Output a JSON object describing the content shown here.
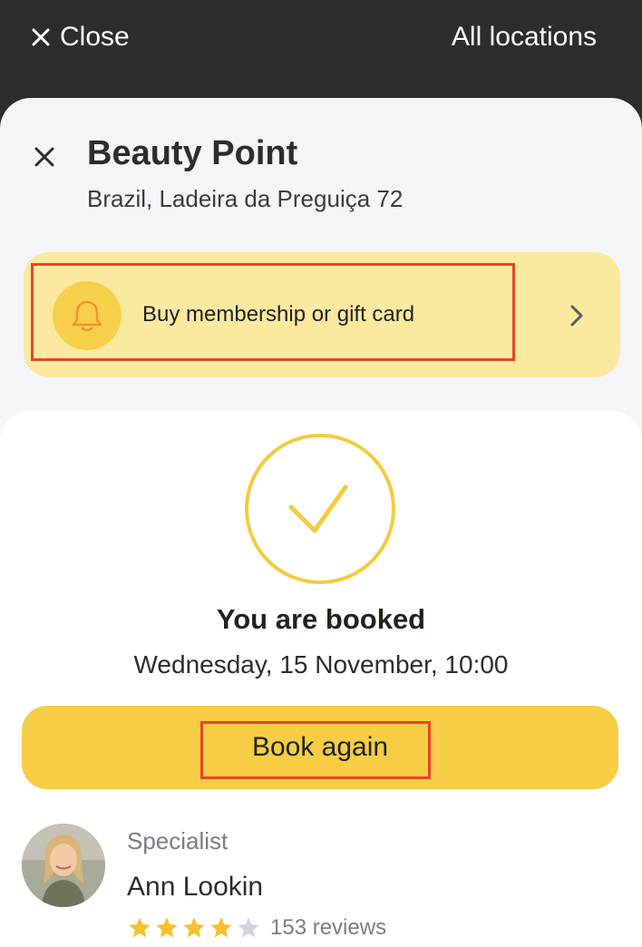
{
  "topbar": {
    "close_label": "Close",
    "all_locations_label": "All locations"
  },
  "salon": {
    "name": "Beauty Point",
    "address": "Brazil, Ladeira da Preguiça 72"
  },
  "membership": {
    "label": "Buy membership or gift card",
    "icon": "bell-icon"
  },
  "booking": {
    "title": "You are booked",
    "datetime": "Wednesday, 15 November, 10:00",
    "book_again_label": "Book again"
  },
  "specialist": {
    "role": "Specialist",
    "name": "Ann Lookin",
    "rating_stars": 4,
    "rating_max": 5,
    "reviews": "153 reviews"
  },
  "colors": {
    "accent_yellow": "#f6cd45",
    "membership_bg": "#fbe9a0",
    "highlight_red": "#e8442c",
    "dark_bar": "#2b2d2f"
  }
}
